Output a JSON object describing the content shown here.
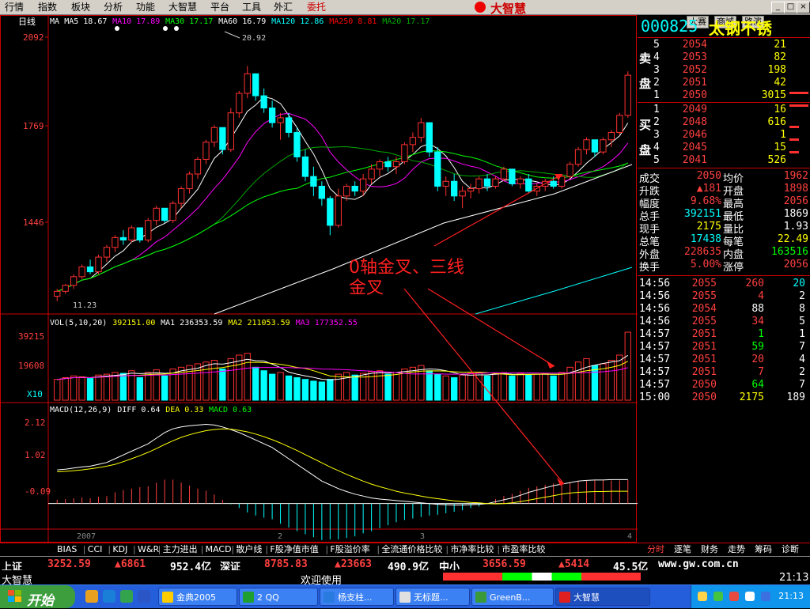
{
  "menu": {
    "items": [
      "行情",
      "指数",
      "板块",
      "分析",
      "功能",
      "大智慧",
      "平台",
      "工具",
      "外汇",
      "委托"
    ]
  },
  "brand": {
    "name": "大智慧"
  },
  "top_buttons": [
    "大赛",
    "商城",
    "路演"
  ],
  "window_buttons": [
    "_",
    "□",
    "×"
  ],
  "chart": {
    "period_label": "日线",
    "ma_legend": [
      {
        "label": "MA",
        "color": "#ffffff"
      },
      {
        "label": "MA5 18.67",
        "color": "#ffffff"
      },
      {
        "label": "MA10 17.89",
        "color": "#ff00ff"
      },
      {
        "label": "MA30 17.17",
        "color": "#00ff00"
      },
      {
        "label": "MA60 16.79",
        "color": "#ffffff"
      },
      {
        "label": "MA120 12.86",
        "color": "#00ffff"
      },
      {
        "label": "MA250 8.81",
        "color": "#ff0000"
      },
      {
        "label": "MA20 17.17",
        "color": "#00aa00"
      }
    ],
    "price_ticks": [
      "2092",
      "1769",
      "1446"
    ],
    "high_label": "20.92",
    "low_label": "11.23",
    "vol_legend": [
      {
        "label": "VOL(5,10,20)",
        "color": "#ffffff"
      },
      {
        "label": "392151.00",
        "color": "#ffff00"
      },
      {
        "label": "MA1 236353.59",
        "color": "#ffffff"
      },
      {
        "label": "MA2 211053.59",
        "color": "#ffff00"
      },
      {
        "label": "MA3 177352.55",
        "color": "#ff00ff"
      }
    ],
    "vol_ticks": [
      "39215",
      "19608"
    ],
    "vol_unit": "X10",
    "macd_legend": [
      {
        "label": "MACD(12,26,9)",
        "color": "#ffffff"
      },
      {
        "label": "DIFF 0.64",
        "color": "#ffffff"
      },
      {
        "label": "DEA 0.33",
        "color": "#ffff00"
      },
      {
        "label": "MACD 0.63",
        "color": "#00ff00"
      }
    ],
    "macd_ticks": [
      "2.12",
      "1.02",
      "-0.09"
    ],
    "x_labels": [
      "2007",
      "2",
      "3",
      "4"
    ],
    "annotation_line1": "0轴金叉、三线",
    "annotation_line2": "金叉"
  },
  "chart_data": {
    "type": "candlestick",
    "price": {
      "ylim": [
        1100,
        2200
      ],
      "candles": [
        [
          1150,
          1180,
          1130,
          1170
        ],
        [
          1170,
          1200,
          1160,
          1195
        ],
        [
          1195,
          1240,
          1180,
          1230
        ],
        [
          1230,
          1280,
          1220,
          1270
        ],
        [
          1270,
          1300,
          1240,
          1250
        ],
        [
          1250,
          1320,
          1240,
          1310
        ],
        [
          1310,
          1360,
          1290,
          1350
        ],
        [
          1350,
          1400,
          1330,
          1390
        ],
        [
          1390,
          1420,
          1360,
          1380
        ],
        [
          1380,
          1440,
          1370,
          1430
        ],
        [
          1430,
          1420,
          1370,
          1380
        ],
        [
          1380,
          1470,
          1370,
          1460
        ],
        [
          1460,
          1520,
          1440,
          1510
        ],
        [
          1510,
          1500,
          1450,
          1460
        ],
        [
          1460,
          1540,
          1450,
          1530
        ],
        [
          1530,
          1600,
          1510,
          1590
        ],
        [
          1590,
          1660,
          1570,
          1650
        ],
        [
          1650,
          1720,
          1630,
          1710
        ],
        [
          1710,
          1790,
          1690,
          1780
        ],
        [
          1780,
          1850,
          1760,
          1840
        ],
        [
          1840,
          1800,
          1730,
          1750
        ],
        [
          1750,
          1920,
          1740,
          1900
        ],
        [
          1900,
          1990,
          1880,
          1980
        ],
        [
          1980,
          2092,
          1960,
          2060
        ],
        [
          2060,
          2030,
          1950,
          1970
        ],
        [
          1970,
          2000,
          1900,
          1920
        ],
        [
          1920,
          1950,
          1840,
          1860
        ],
        [
          1860,
          1900,
          1790,
          1880
        ],
        [
          1880,
          1900,
          1800,
          1820
        ],
        [
          1820,
          1840,
          1700,
          1720
        ],
        [
          1720,
          1750,
          1620,
          1640
        ],
        [
          1640,
          1680,
          1560,
          1600
        ],
        [
          1600,
          1620,
          1520,
          1550
        ],
        [
          1550,
          1560,
          1400,
          1440
        ],
        [
          1440,
          1590,
          1430,
          1560
        ],
        [
          1560,
          1610,
          1540,
          1600
        ],
        [
          1600,
          1620,
          1560,
          1580
        ],
        [
          1580,
          1650,
          1560,
          1630
        ],
        [
          1630,
          1690,
          1610,
          1670
        ],
        [
          1670,
          1710,
          1640,
          1700
        ],
        [
          1700,
          1720,
          1660,
          1680
        ],
        [
          1680,
          1720,
          1650,
          1700
        ],
        [
          1700,
          1780,
          1690,
          1770
        ],
        [
          1770,
          1820,
          1740,
          1800
        ],
        [
          1800,
          1880,
          1780,
          1860
        ],
        [
          1860,
          1840,
          1720,
          1740
        ],
        [
          1740,
          1760,
          1580,
          1600
        ],
        [
          1600,
          1640,
          1560,
          1620
        ],
        [
          1620,
          1650,
          1540,
          1560
        ],
        [
          1560,
          1600,
          1510,
          1580
        ],
        [
          1580,
          1610,
          1550,
          1590
        ],
        [
          1590,
          1640,
          1570,
          1630
        ],
        [
          1630,
          1650,
          1580,
          1600
        ],
        [
          1600,
          1640,
          1590,
          1630
        ],
        [
          1630,
          1680,
          1620,
          1670
        ],
        [
          1670,
          1660,
          1600,
          1610
        ],
        [
          1610,
          1640,
          1590,
          1630
        ],
        [
          1630,
          1650,
          1570,
          1580
        ],
        [
          1580,
          1610,
          1560,
          1600
        ],
        [
          1600,
          1630,
          1580,
          1620
        ],
        [
          1620,
          1640,
          1590,
          1600
        ],
        [
          1600,
          1650,
          1590,
          1640
        ],
        [
          1640,
          1700,
          1630,
          1690
        ],
        [
          1690,
          1760,
          1680,
          1750
        ],
        [
          1750,
          1800,
          1730,
          1790
        ],
        [
          1790,
          1780,
          1720,
          1740
        ],
        [
          1740,
          1800,
          1730,
          1790
        ],
        [
          1790,
          1830,
          1760,
          1820
        ],
        [
          1820,
          1900,
          1810,
          1890
        ],
        [
          1890,
          2070,
          1880,
          2054
        ]
      ]
    },
    "volume": {
      "ylim": [
        0,
        39215
      ],
      "values": [
        12000,
        13000,
        14000,
        13500,
        12500,
        14500,
        15000,
        16000,
        15500,
        17000,
        13000,
        16000,
        17500,
        14000,
        18000,
        19000,
        20000,
        21000,
        22000,
        23000,
        18000,
        24000,
        26000,
        27000,
        19000,
        17000,
        15000,
        16000,
        14000,
        13000,
        12000,
        11000,
        10500,
        12000,
        15000,
        16000,
        14500,
        15500,
        16500,
        17000,
        15000,
        16000,
        18000,
        19000,
        20000,
        17000,
        15000,
        14000,
        13000,
        14500,
        15500,
        16000,
        14000,
        15000,
        16000,
        14000,
        15500,
        14500,
        15000,
        15500,
        14000,
        16000,
        19000,
        22000,
        24000,
        20000,
        21000,
        23000,
        26000,
        39215
      ]
    },
    "macd": {
      "ylim": [
        -0.6,
        2.3
      ],
      "diff": [
        0.9,
        0.92,
        0.95,
        0.98,
        1.0,
        1.05,
        1.1,
        1.2,
        1.3,
        1.4,
        1.5,
        1.6,
        1.75,
        1.9,
        2.0,
        2.05,
        2.08,
        2.1,
        2.12,
        2.1,
        2.05,
        1.98,
        1.9,
        1.8,
        1.7,
        1.6,
        1.5,
        1.35,
        1.2,
        1.05,
        0.9,
        0.75,
        0.6,
        0.5,
        0.4,
        0.32,
        0.25,
        0.2,
        0.15,
        0.12,
        0.1,
        0.08,
        0.06,
        0.04,
        0.02,
        0.0,
        -0.02,
        -0.03,
        -0.04,
        -0.04,
        -0.03,
        -0.02,
        0.0,
        0.05,
        0.1,
        0.15,
        0.22,
        0.3,
        0.36,
        0.42,
        0.48,
        0.52,
        0.56,
        0.6,
        0.62,
        0.63,
        0.63,
        0.64,
        0.64,
        0.64
      ],
      "dea": [
        0.85,
        0.86,
        0.88,
        0.9,
        0.93,
        0.96,
        1.0,
        1.05,
        1.12,
        1.2,
        1.28,
        1.37,
        1.47,
        1.58,
        1.68,
        1.77,
        1.84,
        1.9,
        1.95,
        1.98,
        2.0,
        1.99,
        1.96,
        1.92,
        1.86,
        1.79,
        1.71,
        1.62,
        1.52,
        1.42,
        1.31,
        1.2,
        1.09,
        0.98,
        0.88,
        0.78,
        0.69,
        0.6,
        0.52,
        0.45,
        0.39,
        0.33,
        0.28,
        0.24,
        0.2,
        0.16,
        0.13,
        0.1,
        0.07,
        0.05,
        0.03,
        0.02,
        0.0,
        -0.01,
        0.0,
        0.02,
        0.05,
        0.09,
        0.13,
        0.17,
        0.21,
        0.25,
        0.28,
        0.3,
        0.31,
        0.32,
        0.32,
        0.33,
        0.33,
        0.33
      ],
      "bars": [
        0.1,
        0.12,
        0.14,
        0.16,
        0.14,
        0.18,
        0.2,
        0.3,
        0.36,
        0.4,
        0.44,
        0.46,
        0.56,
        0.64,
        0.64,
        0.56,
        0.48,
        0.4,
        0.34,
        0.24,
        0.1,
        -0.02,
        -0.12,
        -0.24,
        -0.32,
        -0.38,
        -0.42,
        -0.54,
        -0.64,
        -0.74,
        -0.82,
        -0.9,
        -0.98,
        -0.96,
        -0.96,
        -0.92,
        -0.88,
        -0.8,
        -0.74,
        -0.66,
        -0.58,
        -0.5,
        -0.44,
        -0.4,
        -0.36,
        -0.32,
        -0.3,
        -0.26,
        -0.22,
        -0.18,
        -0.12,
        -0.08,
        0.0,
        0.12,
        0.2,
        0.26,
        0.34,
        0.42,
        0.46,
        0.5,
        0.54,
        0.54,
        0.56,
        0.6,
        0.62,
        0.62,
        0.62,
        0.62,
        0.62,
        0.63
      ]
    }
  },
  "quote": {
    "code": "000825",
    "name": "太钢不锈",
    "sell_label": [
      "卖",
      "盘"
    ],
    "buy_label": [
      "买",
      "盘"
    ],
    "sell": [
      {
        "n": "5",
        "p": "2054",
        "v": "21"
      },
      {
        "n": "4",
        "p": "2053",
        "v": "82"
      },
      {
        "n": "3",
        "p": "2052",
        "v": "198"
      },
      {
        "n": "2",
        "p": "2051",
        "v": "42"
      },
      {
        "n": "1",
        "p": "2050",
        "v": "3015"
      }
    ],
    "buy": [
      {
        "n": "1",
        "p": "2049",
        "v": "16"
      },
      {
        "n": "2",
        "p": "2048",
        "v": "616"
      },
      {
        "n": "3",
        "p": "2046",
        "v": "1"
      },
      {
        "n": "4",
        "p": "2045",
        "v": "15"
      },
      {
        "n": "5",
        "p": "2041",
        "v": "526"
      }
    ],
    "stats": [
      {
        "l1": "成交",
        "v1": "2050",
        "l2": "均价",
        "v2": "1962"
      },
      {
        "l1": "升跌",
        "v1": "▲181",
        "l2": "开盘",
        "v2": "1898"
      },
      {
        "l1": "幅度",
        "v1": "9.68%",
        "l2": "最高",
        "v2": "2056"
      },
      {
        "l1": "总手",
        "v1": "392151",
        "l2": "最低",
        "v2": "1869"
      },
      {
        "l1": "现手",
        "v1": "2175",
        "l2": "量比",
        "v2": "1.93"
      },
      {
        "l1": "总笔",
        "v1": "17438",
        "l2": "每笔",
        "v2": "22.49"
      },
      {
        "l1": "外盘",
        "v1": "228635",
        "l2": "内盘",
        "v2": "163516"
      },
      {
        "l1": "换手",
        "v1": "5.00%",
        "l2": "涨停",
        "v2": "2056"
      }
    ],
    "ticks": [
      {
        "t": "14:56",
        "p": "2055",
        "v": "260",
        "n": "20"
      },
      {
        "t": "14:56",
        "p": "2055",
        "v": "4",
        "n": "2"
      },
      {
        "t": "14:56",
        "p": "2054",
        "v": "88",
        "n": "8"
      },
      {
        "t": "14:56",
        "p": "2055",
        "v": "34",
        "n": "5"
      },
      {
        "t": "14:57",
        "p": "2051",
        "v": "1",
        "n": "1"
      },
      {
        "t": "14:57",
        "p": "2051",
        "v": "59",
        "n": "7"
      },
      {
        "t": "14:57",
        "p": "2051",
        "v": "20",
        "n": "4"
      },
      {
        "t": "14:57",
        "p": "2051",
        "v": "7",
        "n": "2"
      },
      {
        "t": "14:57",
        "p": "2050",
        "v": "64",
        "n": "7"
      },
      {
        "t": "15:00",
        "p": "2050",
        "v": "2175",
        "n": "189"
      }
    ]
  },
  "indicator_tabs": [
    "BIAS",
    "CCI",
    "KDJ",
    "W&R",
    "主力进出",
    "MACD",
    "散户线",
    "F股净值市值",
    "F股溢价率",
    "全流通价格比较",
    "市净率比较",
    "市盈率比较"
  ],
  "right_tabs": [
    "分时",
    "逐笔",
    "财务",
    "走势",
    "筹码",
    "诊断"
  ],
  "status": {
    "sh_label": "上证",
    "sh_value": "3252.59",
    "sh_change": "▲6861",
    "sh_amount": "952.4亿",
    "sz_label": "深证",
    "sz_value": "8785.83",
    "sz_change": "▲23663",
    "sz_amount": "490.9亿",
    "sme_label": "中小",
    "sme_value": "3656.59",
    "sme_change": "▲5414",
    "sme_amount": "45.5亿",
    "url": "www.gw.com.cn",
    "app": "大智慧",
    "welcome": "欢迎使用",
    "time": "21:13"
  },
  "taskbar": {
    "start": "开始",
    "items": [
      "金典2005",
      "2 QQ",
      "杨支柱...",
      "无标题...",
      "GreenB...",
      "大智慧"
    ],
    "clock": "21:13"
  }
}
